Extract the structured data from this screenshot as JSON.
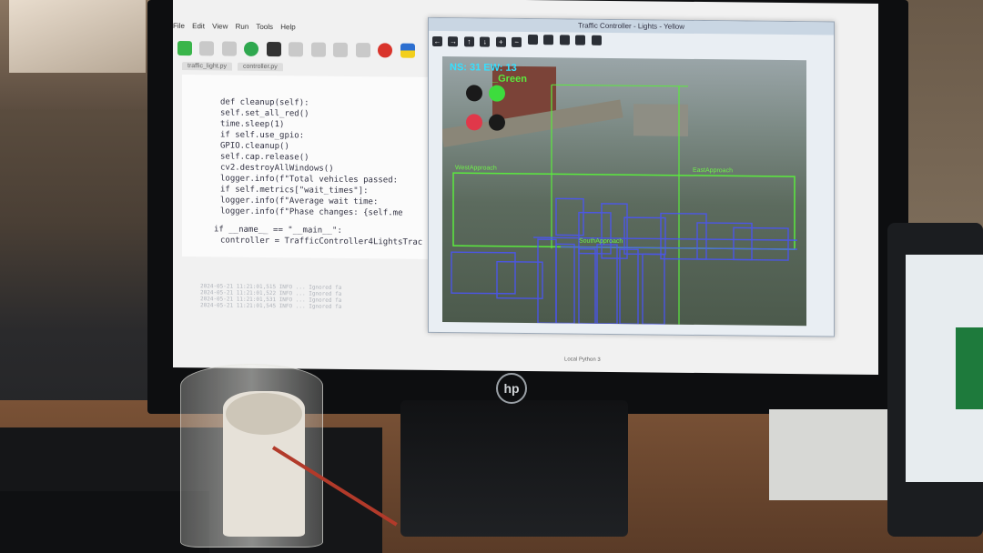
{
  "ide": {
    "menu": [
      "File",
      "Edit",
      "View",
      "Run",
      "Tools",
      "Help"
    ],
    "tabs": [
      "traffic_light.py",
      "controller.py"
    ],
    "code_lines": [
      "def cleanup(self):",
      "    self.set_all_red()",
      "    time.sleep(1)",
      "    if self.use_gpio:",
      "        GPIO.cleanup()",
      "    self.cap.release()",
      "    cv2.destroyAllWindows()",
      "    logger.info(f\"Total vehicles passed:",
      "    if self.metrics[\"wait_times\"]:",
      "        logger.info(f\"Average wait time:",
      "    logger.info(f\"Phase changes: {self.me",
      "if __name__ == \"__main__\":",
      "    controller = TrafficController4LightsTrac"
    ],
    "shell_lines": [
      "2024-05-21 11:21:01,515  INFO  ... Ignored fa",
      "2024-05-21 11:21:01,522  INFO  ... Ignored fa",
      "2024-05-21 11:21:01,531  INFO  ... Ignored fa",
      "2024-05-21 11:21:01,545  INFO  ... Ignored fa"
    ],
    "status": "Local Python 3"
  },
  "traffic_window": {
    "title": "Traffic Controller - Lights - Yellow",
    "hud_text": "NS: 31  EW: 13",
    "signal_label": "_Green",
    "approach_labels": [
      "WestApproach",
      "EastApproach",
      "SouthApproach"
    ],
    "light_colors": {
      "active_green": "#3ddc3d",
      "active_red": "#e0384a",
      "off": "#1a1a1a"
    }
  },
  "monitor": {
    "brand": "hp"
  }
}
